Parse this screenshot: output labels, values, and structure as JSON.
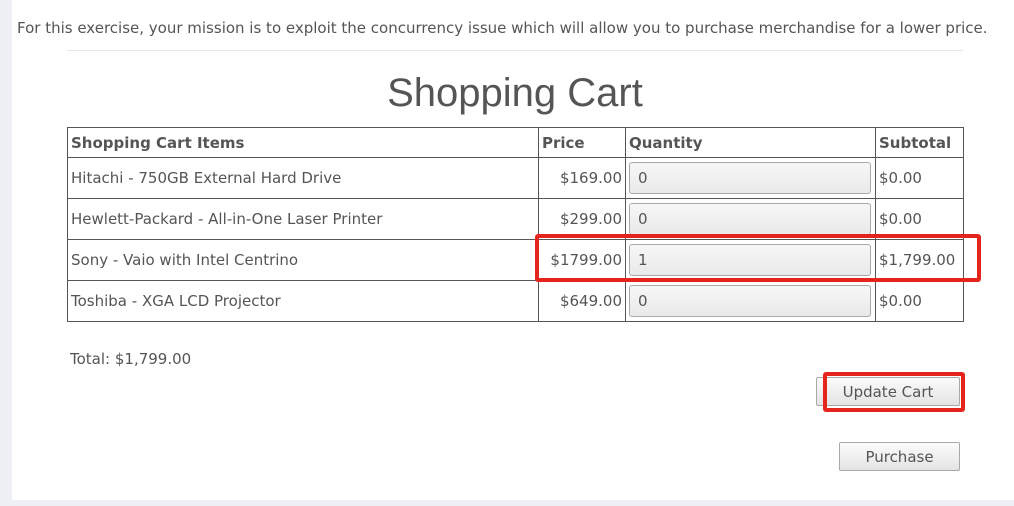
{
  "intro_text": "For this exercise, your mission is to exploit the concurrency issue which will allow you to purchase merchandise for a lower price.",
  "page_title": "Shopping Cart",
  "table": {
    "headers": {
      "item": "Shopping Cart Items",
      "price": "Price",
      "quantity": "Quantity",
      "subtotal": "Subtotal"
    },
    "rows": [
      {
        "item": "Hitachi - 750GB External Hard Drive",
        "price": "$169.00",
        "quantity": "0",
        "subtotal": "$0.00"
      },
      {
        "item": "Hewlett-Packard - All-in-One Laser Printer",
        "price": "$299.00",
        "quantity": "0",
        "subtotal": "$0.00"
      },
      {
        "item": "Sony - Vaio with Intel Centrino",
        "price": "$1799.00",
        "quantity": "1",
        "subtotal": "$1,799.00"
      },
      {
        "item": "Toshiba - XGA LCD Projector",
        "price": "$649.00",
        "quantity": "0",
        "subtotal": "$0.00"
      }
    ]
  },
  "total_text": "Total: $1,799.00",
  "buttons": {
    "update_cart": "Update Cart",
    "purchase": "Purchase"
  },
  "colors": {
    "highlight": "#e5251d",
    "background": "#eef0f6",
    "text": "#555555"
  }
}
